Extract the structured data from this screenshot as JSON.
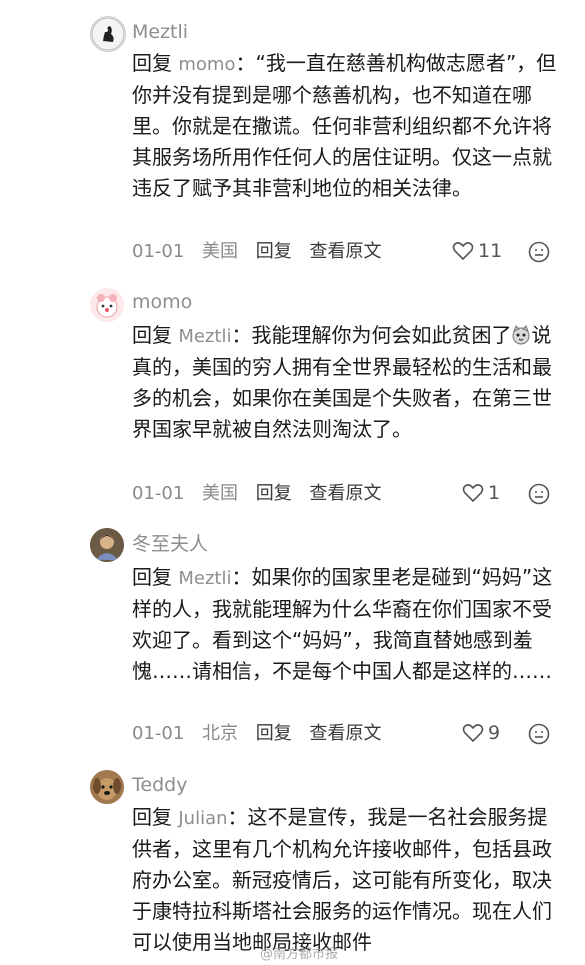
{
  "comments": [
    {
      "username": "Meztli",
      "reply_label": "回复",
      "reply_to": "momo",
      "separator": "：",
      "text": "“我一直在慈善机构做志愿者”，但你并没有提到是哪个慈善机构，也不知道在哪里。你就是在撒谎。任何非营利组织都不允许将其服务场所用作任何人的居住证明。仅这一点就违反了赋予其非营利地位的相关法律。",
      "date": "01-01",
      "location": "美国",
      "reply_action": "回复",
      "view_original": "查看原文",
      "likes": "11"
    },
    {
      "username": "momo",
      "reply_label": "回复",
      "reply_to": "Meztli",
      "separator": "：",
      "text_before_emoji": "我能理解你为何会如此贫困了",
      "emoji": "cat-face-emoji",
      "text_after_emoji": "说真的，美国的穷人拥有全世界最轻松的生活和最多的机会，如果你在美国是个失败者，在第三世界国家早就被自然法则淘汰了。",
      "date": "01-01",
      "location": "美国",
      "reply_action": "回复",
      "view_original": "查看原文",
      "likes": "1"
    },
    {
      "username": "冬至夫人",
      "reply_label": "回复",
      "reply_to": "Meztli",
      "separator": "：",
      "text": "如果你的国家里老是碰到“妈妈”这样的人，我就能理解为什么华裔在你们国家不受欢迎了。看到这个“妈妈”，我简直替她感到羞愧……请相信，不是每个中国人都是这样的……",
      "date": "01-01",
      "location": "北京",
      "reply_action": "回复",
      "view_original": "查看原文",
      "likes": "9"
    },
    {
      "username": "Teddy",
      "reply_label": "回复",
      "reply_to": "Julian",
      "separator": "：",
      "text": "这不是宣传，我是一名社会服务提供者，这里有几个机构允许接收邮件，包括县政府办公室。新冠疫情后，这可能有所变化，取决于康特拉科斯塔社会服务的运作情况。现在人们可以使用当地邮局接收邮件"
    }
  ],
  "watermark": "@南方都市报",
  "icons": {
    "like": "heart-outline-icon",
    "emoji": "smiley-face-icon"
  }
}
